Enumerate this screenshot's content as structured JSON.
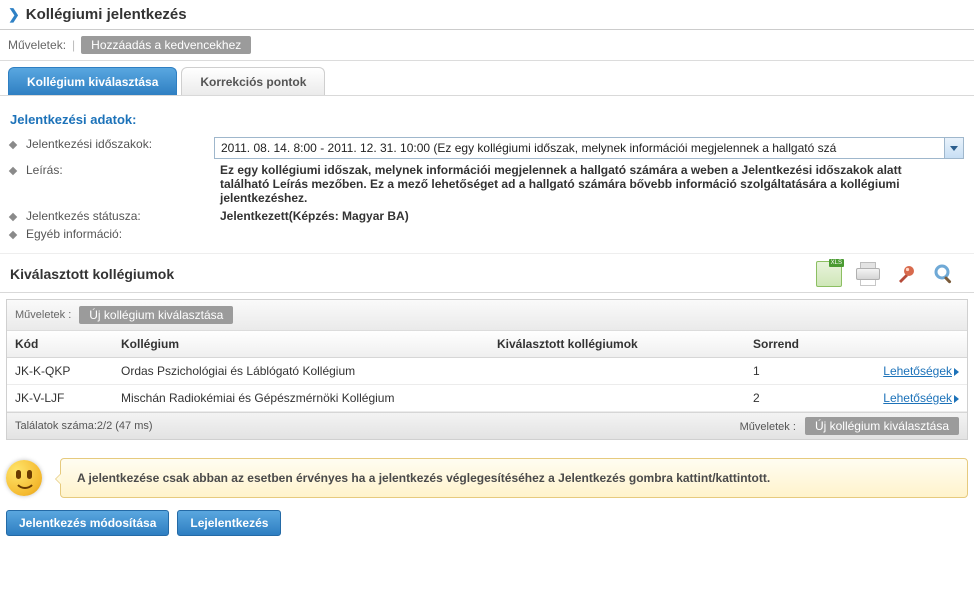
{
  "header": {
    "title": "Kollégiumi jelentkezés",
    "ops_label": "Műveletek:",
    "fav_button": "Hozzáadás a kedvencekhez"
  },
  "tabs": [
    {
      "label": "Kollégium kiválasztása",
      "active": true
    },
    {
      "label": "Korrekciós pontok",
      "active": false
    }
  ],
  "form": {
    "section_title": "Jelentkezési adatok:",
    "rows": {
      "period_label": "Jelentkezési időszakok:",
      "period_value": "2011. 08. 14. 8:00 - 2011. 12. 31. 10:00 (Ez egy kollégiumi időszak, melynek információi megjelennek a hallgató szá",
      "desc_label": "Leírás:",
      "desc_value": "Ez egy kollégiumi időszak, melynek információi megjelennek a hallgató számára a weben a Jelentkezési időszakok alatt található Leírás mezőben. Ez a mező lehetőséget ad a hallgató számára bővebb információ szolgáltatására a kollégiumi jelentkezéshez.",
      "status_label": "Jelentkezés státusza:",
      "status_value": "Jelentkezett(Képzés: Magyar BA)",
      "other_label": "Egyéb információ:"
    }
  },
  "selected_section": {
    "title": "Kiválasztott kollégiumok"
  },
  "grid": {
    "ops_label": "Műveletek :",
    "new_button": "Új kollégium kiválasztása",
    "columns": {
      "kod": "Kód",
      "koll": "Kollégium",
      "kiv": "Kiválasztott kollégiumok",
      "sor": "Sorrend"
    },
    "rows": [
      {
        "kod": "JK-K-QKP",
        "koll": "Ordas Pszichológiai és Láblógató Kollégium",
        "kiv": "",
        "sor": "1",
        "action": "Lehetőségek"
      },
      {
        "kod": "JK-V-LJF",
        "koll": "Mischán Radiokémiai és Gépészmérnöki Kollégium",
        "kiv": "",
        "sor": "2",
        "action": "Lehetőségek"
      }
    ],
    "footer": {
      "results": "Találatok száma:2/2 (47 ms)",
      "ops_label": "Műveletek :",
      "new_button": "Új kollégium kiválasztása"
    }
  },
  "message": "A jelentkezése csak abban az esetben érvényes ha a jelentkezés véglegesítéséhez a Jelentkezés gombra kattint/kattintott.",
  "buttons": {
    "modify": "Jelentkezés módosítása",
    "unsub": "Lejelentkezés"
  }
}
